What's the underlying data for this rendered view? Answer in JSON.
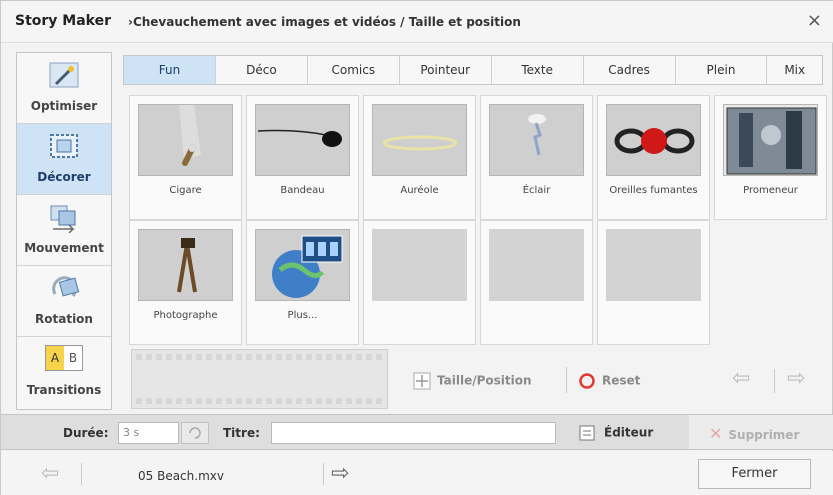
{
  "window": {
    "app_title": "Story Maker",
    "breadcrumb": "›Chevauchement avec images et vidéos / Taille et position",
    "close_glyph": "×"
  },
  "sidebar": {
    "items": [
      {
        "label": "Optimiser",
        "icon": "magic-wand-icon"
      },
      {
        "label": "Décorer",
        "icon": "decorate-frame-icon",
        "active": true
      },
      {
        "label": "Mouvement",
        "icon": "movement-icon"
      },
      {
        "label": "Rotation",
        "icon": "rotation-icon"
      },
      {
        "label": "Transitions",
        "icon": "transitions-icon",
        "ab_a": "A",
        "ab_b": "B"
      }
    ]
  },
  "tabs": [
    {
      "label": "Fun",
      "active": true
    },
    {
      "label": "Déco"
    },
    {
      "label": "Comics"
    },
    {
      "label": "Pointeur"
    },
    {
      "label": "Texte"
    },
    {
      "label": "Cadres"
    },
    {
      "label": "Plein"
    },
    {
      "label": "Mix"
    }
  ],
  "cards": [
    {
      "label": "Cigare",
      "icon": "cigar-icon"
    },
    {
      "label": "Bandeau",
      "icon": "eye-patch-icon"
    },
    {
      "label": "Auréole",
      "icon": "halo-icon"
    },
    {
      "label": "Éclair",
      "icon": "lightning-icon"
    },
    {
      "label": "Oreilles fumantes",
      "icon": "smoking-ears-icon"
    },
    {
      "label": "Promeneur",
      "icon": "walker-photo-icon"
    },
    {
      "label": "Photographe",
      "icon": "photographer-icon"
    },
    {
      "label": "Plus...",
      "icon": "globe-film-icon"
    }
  ],
  "controls": {
    "size_position": "Taille/Position",
    "reset": "Reset",
    "prev_glyph": "⇦",
    "next_glyph": "⇨"
  },
  "bottombar": {
    "duration_label": "Durée:",
    "duration_value": "3 s",
    "title_label": "Titre:",
    "title_value": "",
    "editor": "Éditeur",
    "delete": "Supprimer"
  },
  "footer": {
    "prev_glyph": "⇦",
    "next_glyph": "⇨",
    "filename": "05 Beach.mxv",
    "close": "Fermer"
  },
  "colors": {
    "accent": "#cfe3f7",
    "reset_red": "#e53935"
  }
}
